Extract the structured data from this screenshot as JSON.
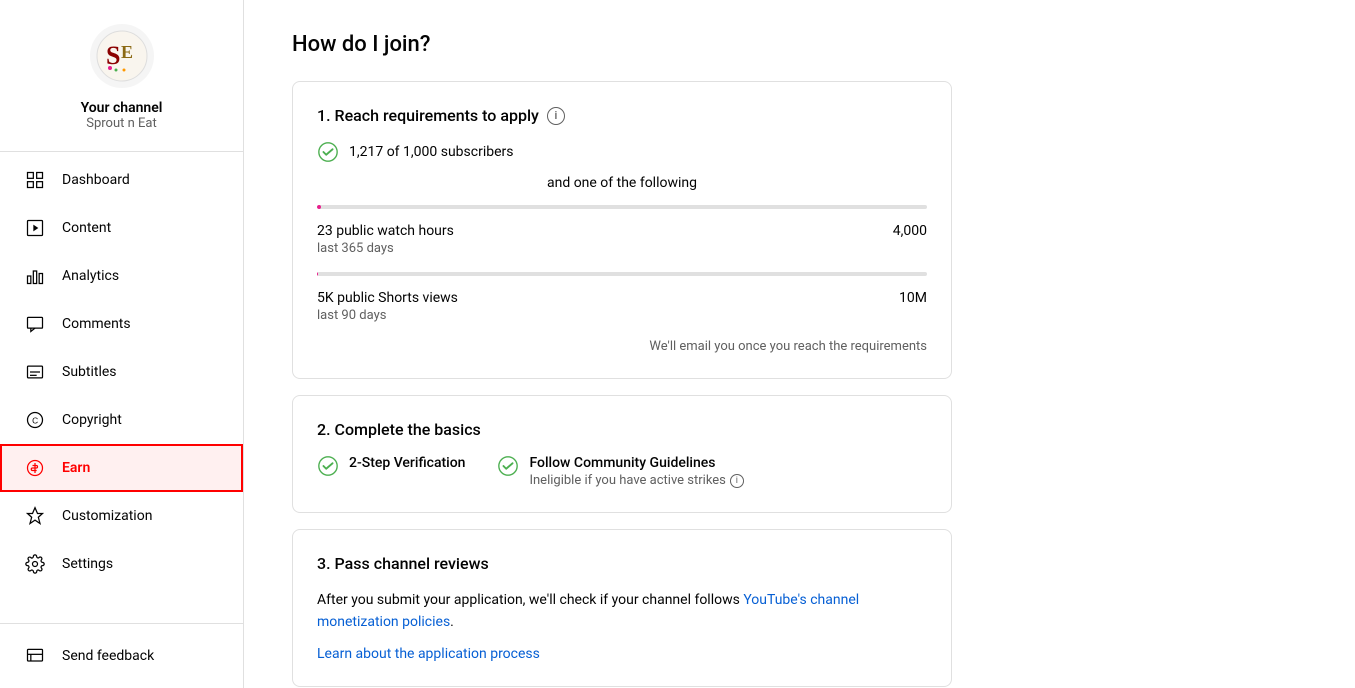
{
  "sidebar": {
    "logo_alt": "Sprout n Eat logo",
    "channel_label": "Your channel",
    "channel_name": "Sprout n Eat",
    "nav_items": [
      {
        "id": "dashboard",
        "label": "Dashboard",
        "icon": "dashboard-icon"
      },
      {
        "id": "content",
        "label": "Content",
        "icon": "content-icon"
      },
      {
        "id": "analytics",
        "label": "Analytics",
        "icon": "analytics-icon"
      },
      {
        "id": "comments",
        "label": "Comments",
        "icon": "comments-icon"
      },
      {
        "id": "subtitles",
        "label": "Subtitles",
        "icon": "subtitles-icon"
      },
      {
        "id": "copyright",
        "label": "Copyright",
        "icon": "copyright-icon"
      },
      {
        "id": "earn",
        "label": "Earn",
        "icon": "earn-icon",
        "active": true
      },
      {
        "id": "customization",
        "label": "Customization",
        "icon": "customization-icon"
      },
      {
        "id": "settings",
        "label": "Settings",
        "icon": "settings-icon"
      }
    ],
    "bottom_items": [
      {
        "id": "send-feedback",
        "label": "Send feedback",
        "icon": "feedback-icon"
      }
    ]
  },
  "main": {
    "page_title": "How do I join?",
    "step1": {
      "title": "1. Reach requirements to apply",
      "info_label": "i",
      "subscribers_check": "1,217 of 1,000 subscribers",
      "and_label": "and one of the following",
      "watch_hours_label": "23 public watch hours",
      "watch_hours_sub": "last 365 days",
      "watch_hours_target": "4,000",
      "watch_hours_percent": 0.575,
      "watch_hours_color": "#e91e8c",
      "shorts_label": "5K public Shorts views",
      "shorts_sub": "last 90 days",
      "shorts_target": "10M",
      "shorts_percent": 0.5,
      "shorts_color": "#e91e8c",
      "email_notice": "We'll email you once you reach the requirements"
    },
    "step2": {
      "title": "2. Complete the basics",
      "item1_label": "2-Step Verification",
      "item2_label": "Follow Community Guidelines",
      "item2_sub": "Ineligible if you have active strikes",
      "info_label": "i"
    },
    "step3": {
      "title": "3. Pass channel reviews",
      "description_before": "After you submit your application, we'll check if your channel follows ",
      "link_text": "YouTube's channel monetization policies",
      "description_after": ".",
      "learn_link": "Learn about the application process"
    }
  }
}
